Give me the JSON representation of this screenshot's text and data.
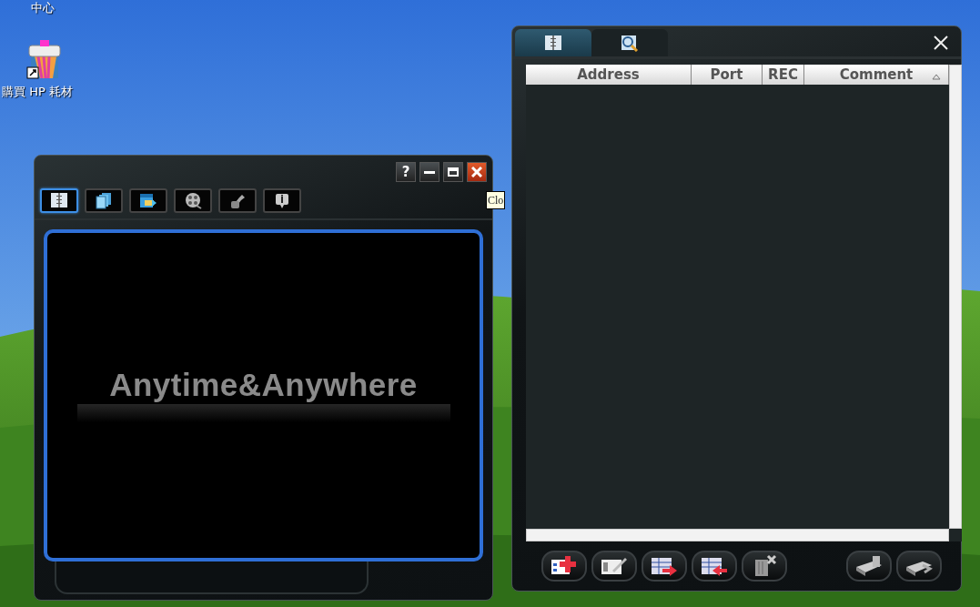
{
  "desktop": {
    "icons": [
      {
        "label": "中心",
        "kind": "text"
      },
      {
        "label": "購買 HP 耗材",
        "kind": "printer"
      }
    ],
    "tooltip": "Clo"
  },
  "main_window": {
    "help_button": "?",
    "tabs": [
      {
        "kind": "book",
        "selected": true
      },
      {
        "kind": "pages",
        "selected": false
      },
      {
        "kind": "calendar",
        "selected": false
      },
      {
        "kind": "film",
        "selected": false
      },
      {
        "kind": "tools",
        "selected": false
      },
      {
        "kind": "info",
        "selected": false
      }
    ],
    "logo_text": "Anytime&Anywhere"
  },
  "address_window": {
    "tabs": [
      {
        "kind": "book",
        "selected": true
      },
      {
        "kind": "search",
        "selected": false
      }
    ],
    "columns": [
      {
        "label": "Address",
        "sorted": false
      },
      {
        "label": "Port",
        "sorted": false
      },
      {
        "label": "REC",
        "sorted": false
      },
      {
        "label": "Comment",
        "sorted": true
      }
    ]
  }
}
